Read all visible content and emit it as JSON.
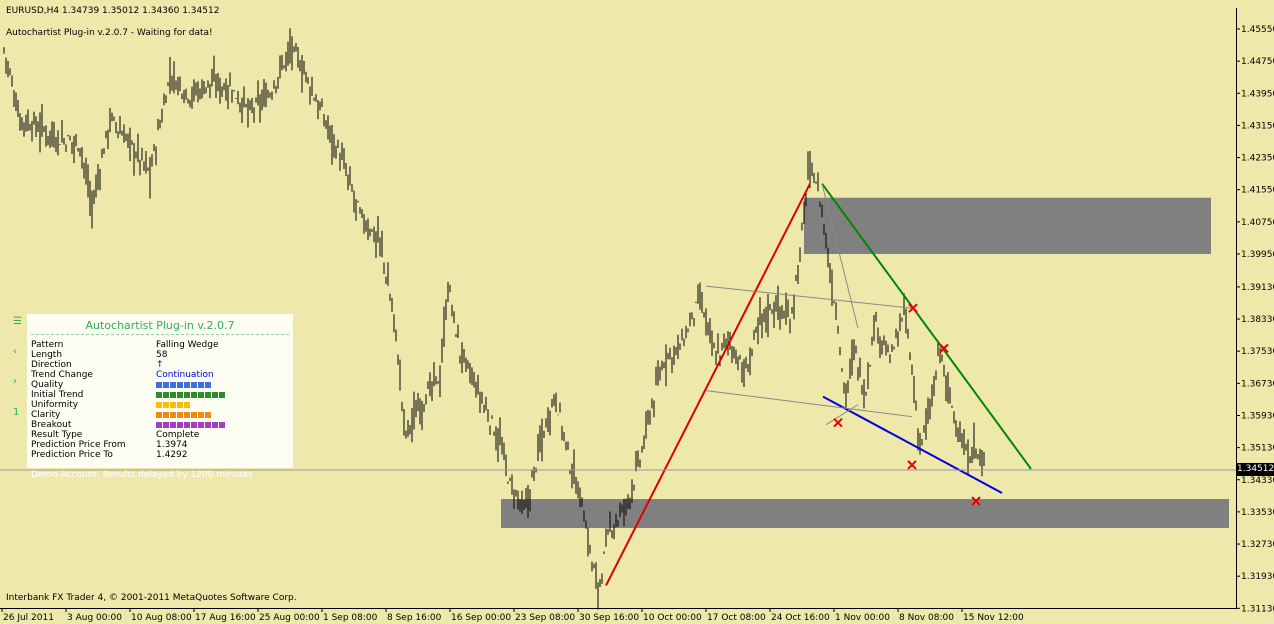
{
  "symbol_line": "EURUSD,H4  1.34739 1.35012 1.34360 1.34512",
  "plugin_status": "Autochartist Plug-in v.2.0.7 - Waiting for data!",
  "footer": "Interbank FX Trader 4, © 2001-2011 MetaQuotes Software Corp.",
  "current_price": "1.34512",
  "price_axis": [
    "1.45550",
    "1.44750",
    "1.43950",
    "1.43150",
    "1.42350",
    "1.41550",
    "1.40750",
    "1.39950",
    "1.39130",
    "1.38330",
    "1.37530",
    "1.36730",
    "1.35930",
    "1.35130",
    "1.34330",
    "1.33530",
    "1.32730",
    "1.31930",
    "1.31130"
  ],
  "time_axis": [
    "26 Jul 2011",
    "3 Aug 00:00",
    "10 Aug 08:00",
    "17 Aug 16:00",
    "25 Aug 00:00",
    "1 Sep 08:00",
    "8 Sep 16:00",
    "16 Sep 00:00",
    "23 Sep 08:00",
    "30 Sep 16:00",
    "10 Oct 00:00",
    "17 Oct 08:00",
    "24 Oct 16:00",
    "1 Nov 00:00",
    "8 Nov 08:00",
    "15 Nov 12:00"
  ],
  "colors": {
    "background": "#EEE8AA",
    "bars": "#000000",
    "zones": "#808080",
    "uptrend": "#DD0000",
    "resistance": "#008800",
    "support": "#0000DD",
    "marker": "#EE0000",
    "panel_title": "#2EAF57"
  },
  "panel": {
    "title": "Autochartist Plug-in v.2.0.7",
    "side_icons": [
      "panel-icon",
      "left-arrow-icon",
      "right-arrow-icon"
    ],
    "side_number": "1",
    "rows": [
      {
        "label": "Pattern",
        "value": "Falling Wedge"
      },
      {
        "label": "Length",
        "value": "58"
      },
      {
        "label": "Direction",
        "value": "↑"
      },
      {
        "label": "Trend Change",
        "value": "Continuation"
      },
      {
        "label": "Quality",
        "value": ""
      },
      {
        "label": "Initial Trend",
        "value": ""
      },
      {
        "label": "Uniformity",
        "value": ""
      },
      {
        "label": "Clarity",
        "value": ""
      },
      {
        "label": "Breakout",
        "value": ""
      },
      {
        "label": "Result Type",
        "value": "Complete"
      },
      {
        "label": "Prediction Price From",
        "value": "1.3974"
      },
      {
        "label": "Prediction Price To",
        "value": "1.4292"
      }
    ],
    "ratings": [
      {
        "name": "Quality",
        "score": 8,
        "color": "#3C6FE0"
      },
      {
        "name": "Initial Trend",
        "score": 10,
        "color": "#2E8B2E"
      },
      {
        "name": "Uniformity",
        "score": 5,
        "color": "#F2C200"
      },
      {
        "name": "Clarity",
        "score": 8,
        "color": "#F08A10"
      },
      {
        "name": "Breakout",
        "score": 10,
        "color": "#A040C0"
      }
    ],
    "demo_note": "Demo Account. Results delayed by 1200 minutes"
  }
}
